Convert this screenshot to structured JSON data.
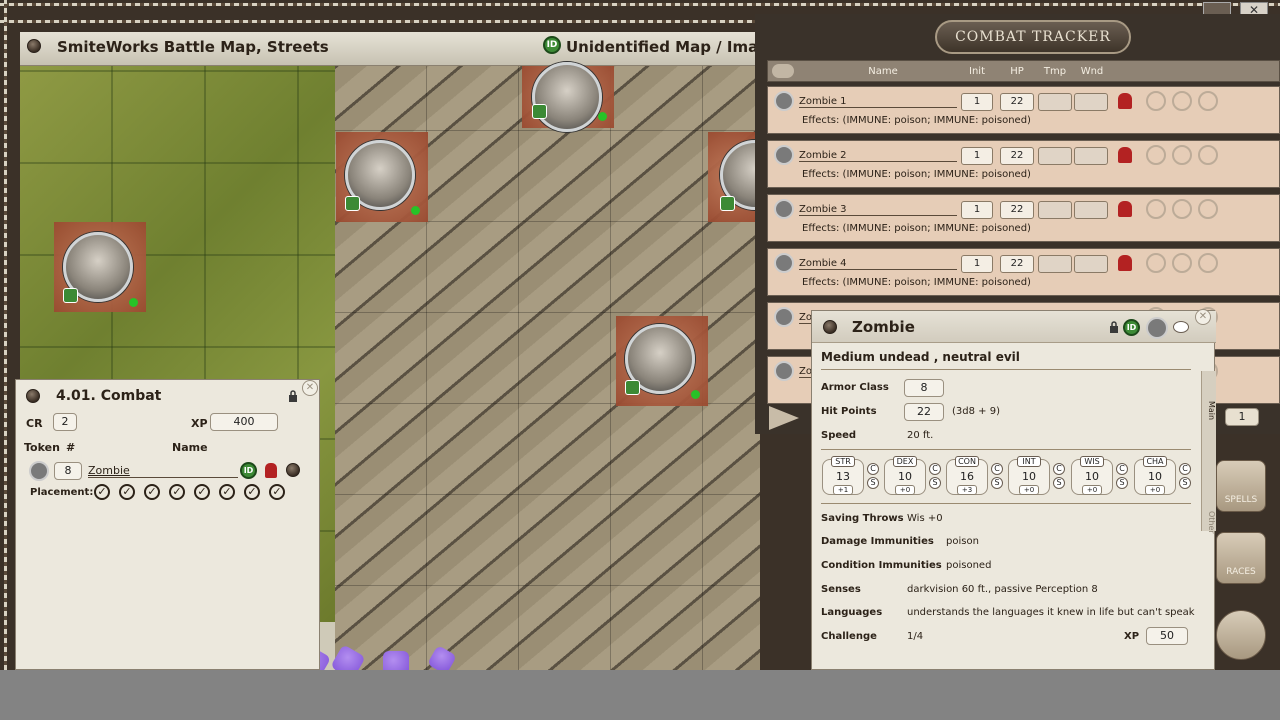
{
  "map_window": {
    "title": "SmiteWorks Battle Map, Streets",
    "id_label": "ID",
    "subtitle": "Unidentified Map / Image"
  },
  "encounter": {
    "title": "4.01. Combat",
    "cr_label": "CR",
    "cr_value": "2",
    "xp_label": "XP",
    "xp_value": "400",
    "token_label": "Token",
    "hash_label": "#",
    "name_label": "Name",
    "count": "8",
    "npc_name": "Zombie",
    "placement_label": "Placement:",
    "placement_check": "✓",
    "id_label": "ID"
  },
  "combat_tracker": {
    "title": "COMBAT TRACKER",
    "columns": {
      "name": "Name",
      "init": "Init",
      "hp": "HP",
      "tmp": "Tmp",
      "wnd": "Wnd"
    },
    "rows": [
      {
        "name": "Zombie 1",
        "init": "1",
        "hp": "22",
        "effects": "Effects: (IMMUNE: poison; IMMUNE: poisoned)"
      },
      {
        "name": "Zombie 2",
        "init": "1",
        "hp": "22",
        "effects": "Effects: (IMMUNE: poison; IMMUNE: poisoned)"
      },
      {
        "name": "Zombie 3",
        "init": "1",
        "hp": "22",
        "effects": "Effects: (IMMUNE: poison; IMMUNE: poisoned)"
      },
      {
        "name": "Zombie 4",
        "init": "1",
        "hp": "22",
        "effects": "Effects: (IMMUNE: poison; IMMUNE: poisoned)"
      },
      {
        "name": "Zo"
      },
      {
        "name": "Zo"
      }
    ],
    "round_value": "1"
  },
  "npc": {
    "name": "Zombie",
    "type_line": "Medium undead , neutral evil",
    "ac_label": "Armor Class",
    "ac_value": "8",
    "hp_label": "Hit Points",
    "hp_value": "22",
    "hp_dice": "(3d8 + 9)",
    "speed_label": "Speed",
    "speed_value": "20 ft.",
    "stats": [
      {
        "name": "STR",
        "value": "13",
        "mod": "+1"
      },
      {
        "name": "DEX",
        "value": "10",
        "mod": "+0"
      },
      {
        "name": "CON",
        "value": "16",
        "mod": "+3"
      },
      {
        "name": "INT",
        "value": "10",
        "mod": "+0"
      },
      {
        "name": "WIS",
        "value": "10",
        "mod": "+0"
      },
      {
        "name": "CHA",
        "value": "10",
        "mod": "+0"
      }
    ],
    "check_letter": "C",
    "save_letter": "S",
    "saving_throws_label": "Saving Throws",
    "saving_throws_value": "Wis +0",
    "damage_imm_label": "Damage Immunities",
    "damage_imm_value": "poison",
    "condition_imm_label": "Condition Immunities",
    "condition_imm_value": "poisoned",
    "senses_label": "Senses",
    "senses_value": "darkvision 60 ft., passive Perception 8",
    "languages_label": "Languages",
    "languages_value": "understands the languages it knew in life but can't speak",
    "challenge_label": "Challenge",
    "challenge_value": "1/4",
    "xp_label": "XP",
    "xp_value": "50",
    "tab_main": "Main",
    "tab_other": "Other",
    "id_label": "ID"
  },
  "sidebar": {
    "spells": "SPELLS",
    "races": "RACES"
  },
  "colors": {
    "dice": "#8a5ce0",
    "id_green": "#3c8a35",
    "tracker_row": "#e6cdb7"
  }
}
